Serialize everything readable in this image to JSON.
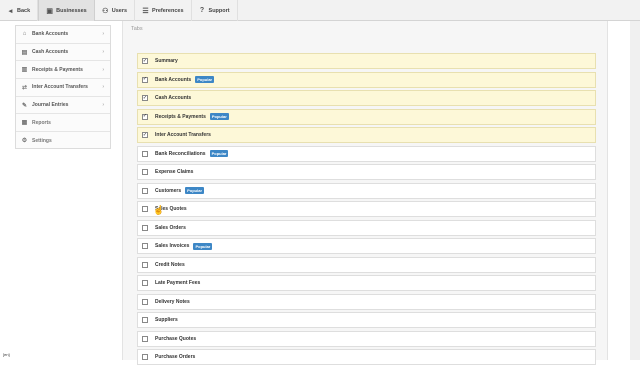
{
  "topbar": {
    "back": "Back",
    "businesses": "Businesses",
    "users": "Users",
    "preferences": "Preferences",
    "support": "Support"
  },
  "sidebar": {
    "items": [
      {
        "label": "Bank Accounts",
        "icon": "bank-icon",
        "chevron": true
      },
      {
        "label": "Cash Accounts",
        "icon": "cash-icon",
        "chevron": true
      },
      {
        "label": "Receipts & Payments",
        "icon": "receipts-icon",
        "chevron": true
      },
      {
        "label": "Inter Account Transfers",
        "icon": "transfer-icon",
        "chevron": true
      },
      {
        "label": "Journal Entries",
        "icon": "journal-icon",
        "chevron": true
      },
      {
        "label": "Reports",
        "icon": "reports-icon",
        "chevron": false
      },
      {
        "label": "Settings",
        "icon": "gear-icon",
        "chevron": false
      }
    ]
  },
  "main": {
    "section_label": "Tabs",
    "tabs": [
      {
        "label": "Summary",
        "checked": true,
        "popular": false
      },
      {
        "label": "Bank Accounts",
        "checked": true,
        "popular": true
      },
      {
        "label": "Cash Accounts",
        "checked": true,
        "popular": false
      },
      {
        "label": "Receipts & Payments",
        "checked": true,
        "popular": true
      },
      {
        "label": "Inter Account Transfers",
        "checked": true,
        "popular": false
      },
      {
        "label": "Bank Reconciliations",
        "checked": false,
        "popular": true
      },
      {
        "label": "Expense Claims",
        "checked": false,
        "popular": false
      },
      {
        "label": "Customers",
        "checked": false,
        "popular": true
      },
      {
        "label": "Sales Quotes",
        "checked": false,
        "popular": false
      },
      {
        "label": "Sales Orders",
        "checked": false,
        "popular": false
      },
      {
        "label": "Sales Invoices",
        "checked": false,
        "popular": true
      },
      {
        "label": "Credit Notes",
        "checked": false,
        "popular": false
      },
      {
        "label": "Late Payment Fees",
        "checked": false,
        "popular": false
      },
      {
        "label": "Delivery Notes",
        "checked": false,
        "popular": false
      },
      {
        "label": "Suppliers",
        "checked": false,
        "popular": false
      },
      {
        "label": "Purchase Quotes",
        "checked": false,
        "popular": false
      },
      {
        "label": "Purchase Orders",
        "checked": false,
        "popular": false
      }
    ],
    "popular_badge": "Popular"
  },
  "corner_text": "[en]",
  "colors": {
    "checked_row_bg": "#fdf8d8",
    "badge_bg": "#3d87c6"
  }
}
